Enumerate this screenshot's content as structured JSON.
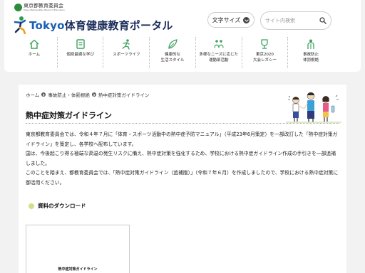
{
  "header": {
    "board_name": "東京都教育委員会",
    "board_name_en": "Tokyo Metropolitan Board of Education",
    "site_title_en": "Tokyo",
    "site_title_ja": "体育健康教育ポータル",
    "font_size_label": "文字サイズ",
    "search_placeholder": "サイト内検索"
  },
  "nav": [
    {
      "label": "ホーム",
      "icon": "home-icon"
    },
    {
      "label": "個別最適な学び",
      "icon": "learning-icon"
    },
    {
      "label": "スポーツライフ",
      "icon": "sports-icon"
    },
    {
      "label": "健康的な\n生活スタイル",
      "icon": "healthy-lifestyle-icon"
    },
    {
      "label": "多様なニーズに応じた\n運動部活動",
      "icon": "club-activity-icon"
    },
    {
      "label": "東京2020\n大会レガシー",
      "icon": "legacy-icon"
    },
    {
      "label": "事故防止\n体罰根絶",
      "icon": "accident-prevention-icon"
    }
  ],
  "breadcrumb": [
    "ホーム",
    "事故防止・体罰根絶",
    "熱中症対策ガイドライン"
  ],
  "page_title": "熱中症対策ガイドライン",
  "body": [
    "東京都教育委員会では、令和４年７月に「体育・スポーツ活動中の熱中症予防マニュアル」（平成23年6月策定）を一部改訂した「熱中症対策ガイドライン」を策定し、各学校へ配布しています。",
    "国は、今後起こり得る極端な高温の発生リスクに備え、熱中症対策を強化するため、学校における熱中症ガイドライン作成の手引きを一部追補しました。",
    "このことを踏まえ、都教育委員会では、「熱中症対策ガイドライン（追補版）」（令和７年６月）を作成しましたので、学校における熱中症対策に御活用ください。"
  ],
  "download_heading": "資料のダウンロード",
  "document_thumb_title": "熱中症対策ガイドライン",
  "colors": {
    "brand_navy": "#1a2d5a",
    "brand_blue": "#1a5fb4",
    "nav_icon_green": "#3da35d",
    "accent_lime": "#d6dd8c",
    "background": "#f2f2f2"
  }
}
